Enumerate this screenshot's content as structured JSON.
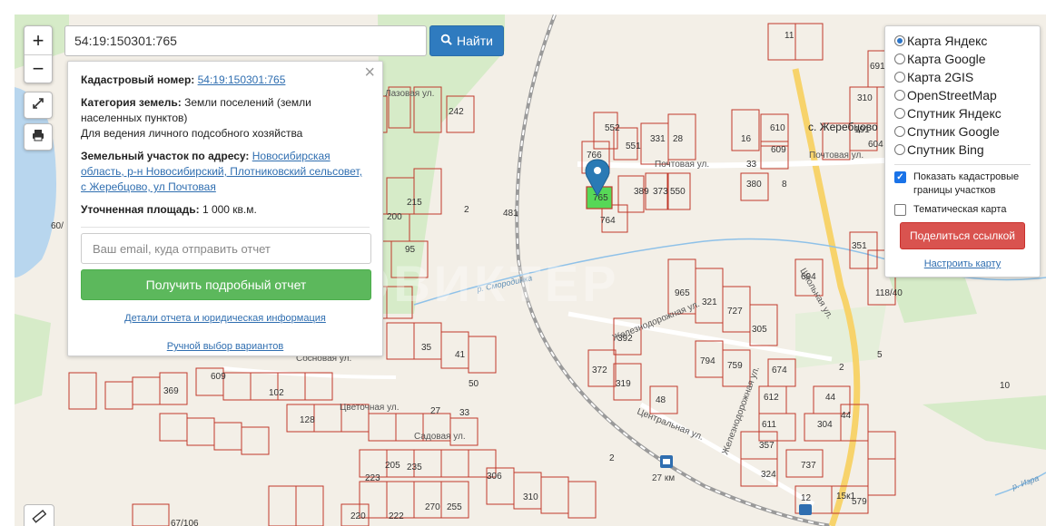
{
  "search": {
    "value": "54:19:150301:765",
    "button_label": "Найти"
  },
  "zoom": {
    "in_label": "+",
    "out_label": "−"
  },
  "info": {
    "cadastral_label": "Кадастровый номер:",
    "cadastral_value": "54:19:150301:765",
    "category_label": "Категория земель:",
    "category_value": "Земли поселений (земли населенных пунктов)",
    "usage": "Для ведения личного подсобного хозяйства",
    "address_label": "Земельный участок по адресу:",
    "address_value": "Новосибирская область, р-н Новосибирский, Плотниковский сельсовет, с Жеребцово, ул Почтовая",
    "area_label": "Уточненная площадь:",
    "area_value": "1 000 кв.м.",
    "email_placeholder": "Ваш email, куда отправить отчет",
    "report_button": "Получить подробный отчет",
    "details_link": "Детали отчета и юридическая информация",
    "manual_link": "Ручной выбор вариантов",
    "close": "×"
  },
  "layers": {
    "options": [
      {
        "label": "Карта Яндекс",
        "selected": true
      },
      {
        "label": "Карта Google",
        "selected": false
      },
      {
        "label": "Карта 2GIS",
        "selected": false
      },
      {
        "label": "OpenStreetMap",
        "selected": false
      },
      {
        "label": "Спутник Яндекс",
        "selected": false
      },
      {
        "label": "Спутник Google",
        "selected": false
      },
      {
        "label": "Спутник Bing",
        "selected": false
      }
    ],
    "show_boundaries": "Показать кадастровые границы участков",
    "show_boundaries_checked": true,
    "thematic": "Тематическая карта",
    "thematic_checked": false,
    "share_button": "Поделиться ссылкой",
    "setup_link": "Настроить карту"
  },
  "map": {
    "village": "с. Жеребцово",
    "streets": {
      "pochtovaya": "Почтовая ул.",
      "pochtovaya2": "Почтовая ул.",
      "zheleznodorozhnaya": "Железнодорожная ул.",
      "zheleznodorozhnaya2": "Железнодорожная ул.",
      "shkolnaya": "Школьная ул.",
      "tsentralnaya": "Центральная ул.",
      "tsvetochnaya": "Цветочная ул.",
      "sadovaya": "Садовая ул.",
      "sosnovaya": "Сосновая ул.",
      "lazovaya": "Лазовая ул."
    },
    "river": "р. Смородинка",
    "river2": "р. Изра",
    "station": "27 км",
    "watermark": "НЕОВИКТЕР",
    "parcel_numbers": [
      "11",
      "552",
      "551",
      "766",
      "331",
      "28",
      "610",
      "16",
      "609",
      "191",
      "310",
      "604",
      "691",
      "389",
      "373",
      "550",
      "380",
      "8",
      "33",
      "2",
      "481",
      "764",
      "765",
      "242",
      "215",
      "200",
      "95",
      "60",
      "965",
      "321",
      "727",
      "305",
      "392",
      "372",
      "319",
      "794",
      "759",
      "674",
      "612",
      "611",
      "357",
      "324",
      "737",
      "304",
      "44",
      "48",
      "579",
      "12",
      "5",
      "10",
      "694",
      "351",
      "118/40",
      "15к1",
      "67/106",
      "369",
      "609",
      "102",
      "128",
      "223",
      "205",
      "235",
      "220",
      "222",
      "270",
      "255",
      "310",
      "306",
      "27",
      "33",
      "35",
      "41",
      "50"
    ]
  },
  "colors": {
    "parcel_line": "#c0392b",
    "selected_parcel": "#57d857",
    "road": "#f7d36b",
    "water": "#b8d6ee",
    "green": "#d6ebc8",
    "search_button": "#2f7bbf",
    "report_button": "#5cb85c",
    "share_button": "#d9534f"
  },
  "icons": {
    "search": "search-icon",
    "fullscreen": "fullscreen-icon",
    "print": "print-icon",
    "ruler": "ruler-icon",
    "marker": "map-marker-icon",
    "station": "station-icon"
  }
}
